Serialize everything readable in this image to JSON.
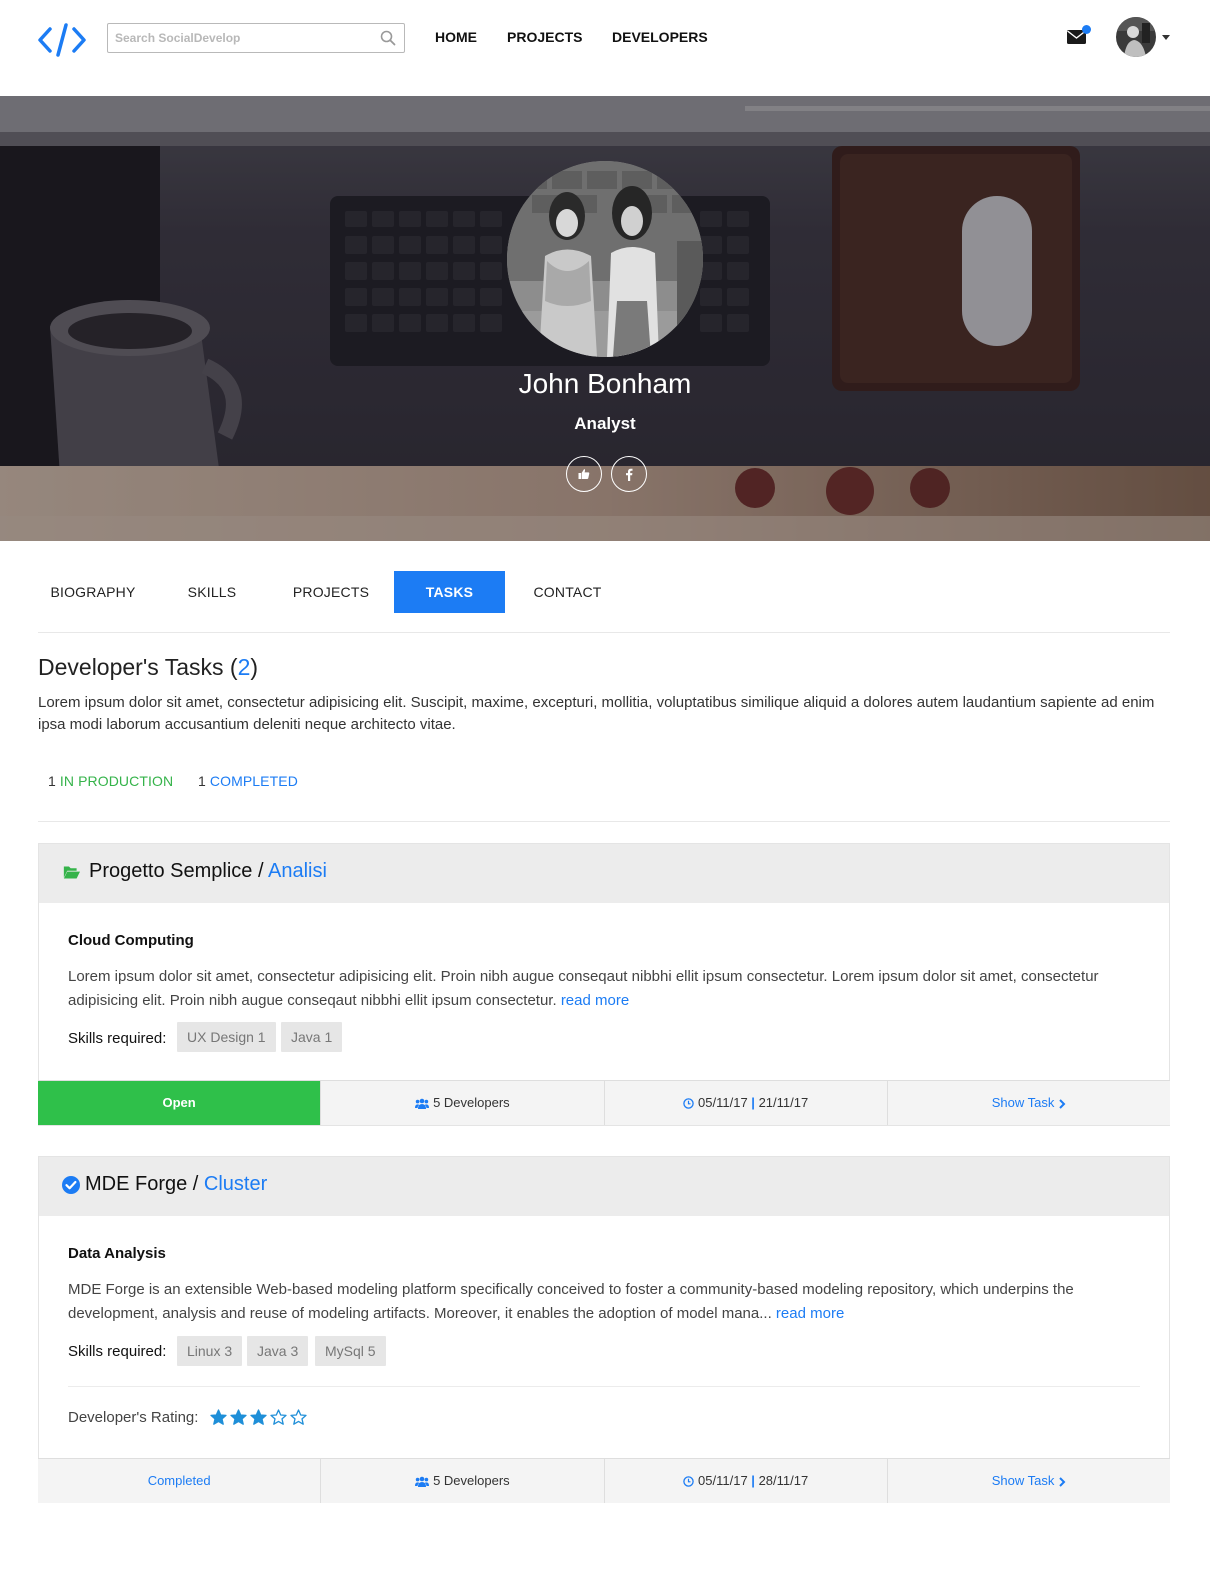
{
  "navbar": {
    "search_placeholder": "Search SocialDevelop",
    "links": [
      "HOME",
      "PROJECTS",
      "DEVELOPERS"
    ],
    "accent_color": "#1c7cf4"
  },
  "profile": {
    "name": "John Bonham",
    "role": "Analyst",
    "social": [
      "thumbs-up-icon",
      "facebook-icon"
    ]
  },
  "tabs": [
    "BIOGRAPHY",
    "SKILLS",
    "PROJECTS",
    "TASKS",
    "CONTACT"
  ],
  "active_tab": "TASKS",
  "section": {
    "title": "Developer's Tasks",
    "count": "2",
    "description": "Lorem ipsum dolor sit amet, consectetur adipisicing elit. Suscipit, maxime, excepturi, mollitia, voluptatibus similique aliquid a dolores autem laudantium sapiente ad enim ipsa modi laborum accusantium deleniti neque architecto vitae.",
    "stats": [
      {
        "count": "1",
        "label": "IN PRODUCTION",
        "color": "#35b34a"
      },
      {
        "count": "1",
        "label": "COMPLETED",
        "color": "#1c7cf4"
      }
    ]
  },
  "tasks": [
    {
      "project": "Progetto Semplice",
      "category": "Analisi",
      "header_icon": "folder-open-icon",
      "name": "Cloud Computing",
      "description": "Lorem ipsum dolor sit amet, consectetur adipisicing elit. Proin nibh augue conseqaut nibbhi ellit ipsum consectetur. Lorem ipsum dolor sit amet, consectetur adipisicing elit. Proin nibh augue conseqaut nibbhi ellit ipsum consectetur.",
      "read_more": "read more",
      "skills_label": "Skills required:",
      "skills": [
        "UX Design 1",
        "Java 1"
      ],
      "status": "Open",
      "status_color": "#2fc04a",
      "developers": "5 Developers",
      "start_date": "05/11/17",
      "end_date": "21/11/17",
      "date_sep": "|",
      "show_task": "Show Task"
    },
    {
      "project": "MDE Forge",
      "category": "Cluster",
      "header_icon": "check-circle-icon",
      "name": "Data Analysis",
      "description": "MDE Forge is an extensible Web-based modeling platform specifically conceived to foster a community-based modeling  repository, which underpins the development, analysis and reuse of modeling artifacts. Moreover, it enables the adoption of model mana...",
      "read_more": "read more",
      "skills_label": "Skills required:",
      "skills": [
        "Linux 3",
        "Java 3",
        "MySql 5"
      ],
      "rating_label": "Developer's Rating:",
      "rating": 3,
      "rating_max": 5,
      "status": "Completed",
      "developers": "5 Developers",
      "start_date": "05/11/17",
      "end_date": "28/11/17",
      "date_sep": "|",
      "show_task": "Show Task"
    }
  ]
}
